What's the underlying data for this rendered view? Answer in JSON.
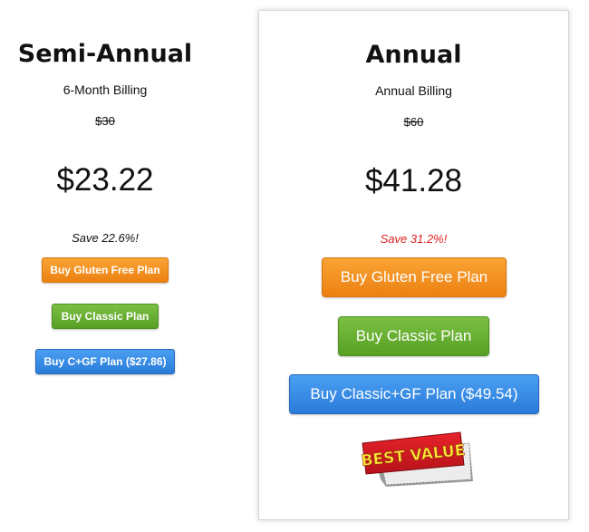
{
  "plans": [
    {
      "title": "Semi-Annual",
      "billing": "6-Month Billing",
      "old_price": "$30",
      "price": "$23.22",
      "save": "Save 22.6%!",
      "buttons": {
        "gluten_free": "Buy Gluten Free Plan",
        "classic": "Buy Classic Plan",
        "combo": "Buy C+GF Plan ($27.86)"
      }
    },
    {
      "title": "Annual",
      "billing": "Annual Billing",
      "old_price": "$60",
      "price": "$41.28",
      "save": "Save 31.2%!",
      "buttons": {
        "gluten_free": "Buy Gluten Free Plan",
        "classic": "Buy Classic Plan",
        "combo": "Buy Classic+GF Plan ($49.54)"
      },
      "badge": "BEST VALUE"
    }
  ],
  "colors": {
    "orange_button": "#f39423",
    "green_button": "#67af32",
    "blue_button": "#358ae6",
    "save_highlight": "#dd1f1f",
    "badge_red": "#d7191f",
    "badge_yellow": "#ffe23a"
  }
}
